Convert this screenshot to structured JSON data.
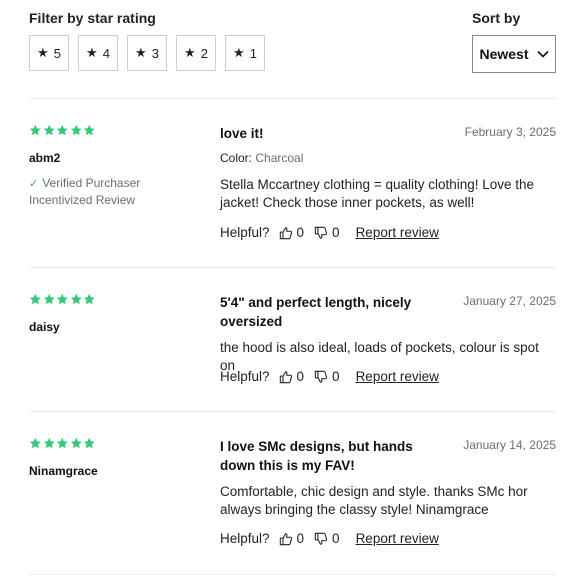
{
  "filter": {
    "title": "Filter by star rating",
    "star_glyph": "★",
    "options": [
      "5",
      "4",
      "3",
      "2",
      "1"
    ]
  },
  "sort": {
    "title": "Sort by",
    "selected": "Newest"
  },
  "colors": {
    "star_green": "#2ecc71",
    "check_green": "#2db34a",
    "muted_text": "#6d6d6d"
  },
  "reviews": [
    {
      "rating": 5,
      "author": "abm2",
      "verified_label": "Verified Purchaser",
      "incentivized_label": "Incentivized Review",
      "title": "love it!",
      "date": "February 3, 2025",
      "color_label": "Color:",
      "color_value": "Charcoal",
      "body": "Stella Mccartney clothing = quality clothing! Love the jacket! Check those inner pockets, as well!",
      "helpful_label": "Helpful?",
      "up_count": "0",
      "down_count": "0",
      "report_label": "Report review"
    },
    {
      "rating": 5,
      "author": "daisy",
      "title": "5'4\" and perfect length, nicely oversized",
      "date": "January 27, 2025",
      "body": "the hood is also ideal, loads of pockets, colour is spot on",
      "helpful_label": "Helpful?",
      "up_count": "0",
      "down_count": "0",
      "report_label": "Report review"
    },
    {
      "rating": 5,
      "author": "Ninamgrace",
      "title": "I love SMc designs, but hands down this is my FAV!",
      "date": "January 14, 2025",
      "body": "Comfortable, chic design and style. thanks SMc hor always bringing the classy style! Ninamgrace",
      "helpful_label": "Helpful?",
      "up_count": "0",
      "down_count": "0",
      "report_label": "Report review"
    }
  ]
}
